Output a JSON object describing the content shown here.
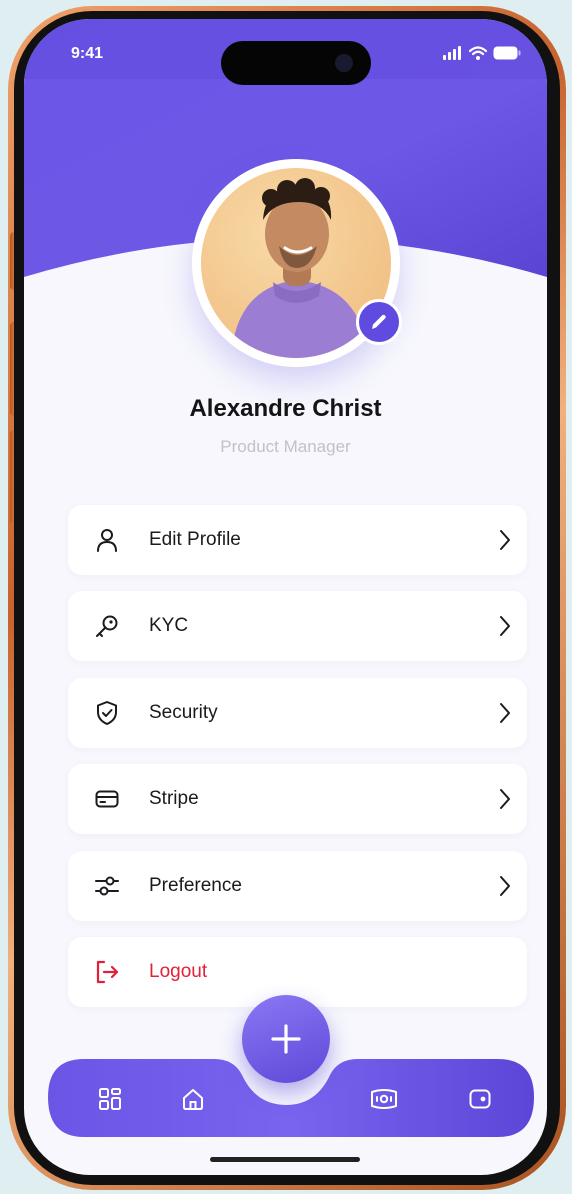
{
  "status_bar": {
    "time": "9:41",
    "icons": [
      "signal-icon",
      "wifi-icon",
      "battery-icon"
    ]
  },
  "profile": {
    "name": "Alexandre Christ",
    "role": "Product Manager",
    "avatar_icon": "avatar-photo",
    "edit_icon": "pencil-icon"
  },
  "menu": [
    {
      "label": "Edit Profile",
      "icon": "user-icon"
    },
    {
      "label": "KYC",
      "icon": "key-icon"
    },
    {
      "label": "Security",
      "icon": "shield-check-icon"
    },
    {
      "label": "Stripe",
      "icon": "card-icon"
    },
    {
      "label": "Preference",
      "icon": "sliders-icon"
    },
    {
      "label": "Logout",
      "icon": "logout-icon"
    }
  ],
  "bottom_nav": {
    "items": [
      "grid-icon",
      "home-icon",
      "add-icon",
      "money-icon",
      "wallet-icon"
    ]
  },
  "colors": {
    "primary": "#5d49d8",
    "primary_light": "#8a78f4",
    "logout": "#e2203a",
    "background": "#f7f7fd",
    "frame": "#c8622e"
  }
}
